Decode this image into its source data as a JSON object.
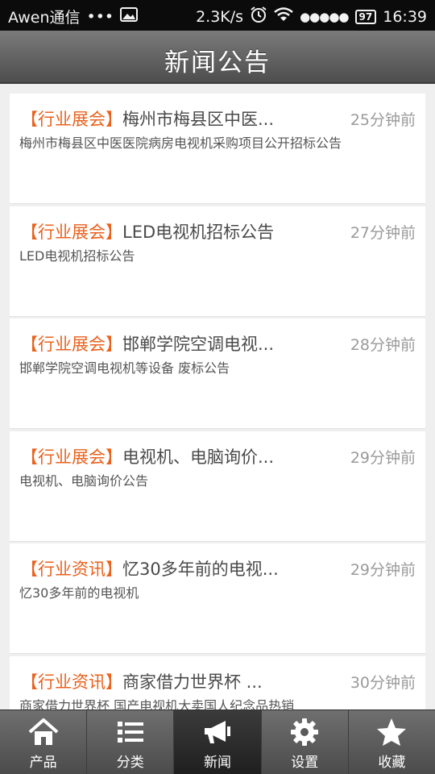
{
  "statusbar": {
    "carrier": "Awen通信",
    "dots": "•••",
    "speed": "2.3K/s",
    "signal": "●●●●●",
    "battery": "97",
    "time": "16:39"
  },
  "header": {
    "title": "新闻公告"
  },
  "news": [
    {
      "category": "【行业展会】",
      "title": "梅州市梅县区中医...",
      "time": "25分钟前",
      "summary": "梅州市梅县区中医医院病房电视机采购项目公开招标公告"
    },
    {
      "category": "【行业展会】",
      "title": "LED电视机招标公告",
      "time": "27分钟前",
      "summary": "LED电视机招标公告"
    },
    {
      "category": "【行业展会】",
      "title": "邯郸学院空调电视...",
      "time": "28分钟前",
      "summary": "邯郸学院空调电视机等设备 废标公告"
    },
    {
      "category": "【行业展会】",
      "title": "电视机、电脑询价...",
      "time": "29分钟前",
      "summary": "电视机、电脑询价公告"
    },
    {
      "category": "【行业资讯】",
      "title": "忆30多年前的电视...",
      "time": "29分钟前",
      "summary": "忆30多年前的电视机"
    },
    {
      "category": "【行业资讯】",
      "title": "商家借力世界杯 ...",
      "time": "30分钟前",
      "summary": "商家借力世界杯 国产电视机大卖国人纪念品热销"
    }
  ],
  "tabs": [
    {
      "label": "产品",
      "icon": "home-icon"
    },
    {
      "label": "分类",
      "icon": "list-icon"
    },
    {
      "label": "新闻",
      "icon": "megaphone-icon"
    },
    {
      "label": "设置",
      "icon": "gear-icon"
    },
    {
      "label": "收藏",
      "icon": "star-icon"
    }
  ],
  "colors": {
    "category": "#e9621e",
    "title_bar": "#5f5f5f",
    "active_tab": "#2b2b2b"
  }
}
